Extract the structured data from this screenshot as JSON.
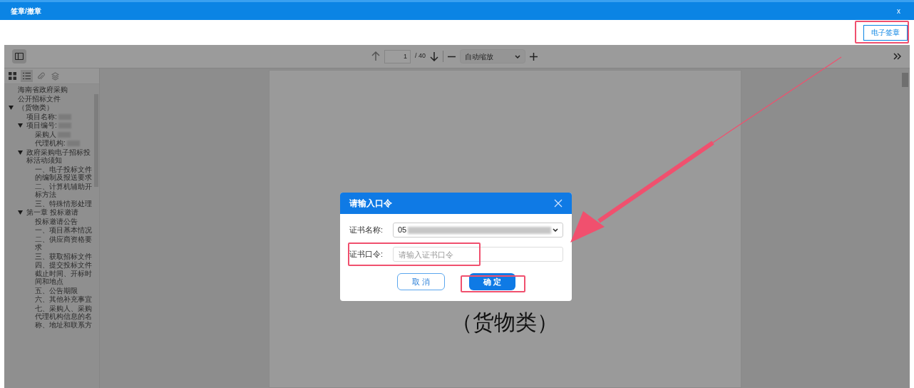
{
  "window": {
    "title": "签章/撤章",
    "close": "x"
  },
  "top_bar": {
    "button": "电子签章"
  },
  "toolbar": {
    "page": "1",
    "page_count": "/ 40",
    "zoom": "自动缩放"
  },
  "sidebar_views": [
    {
      "kind": "thumbnails",
      "selected": false
    },
    {
      "kind": "outline",
      "selected": true
    },
    {
      "kind": "attachments",
      "selected": false
    },
    {
      "kind": "layers",
      "selected": false
    }
  ],
  "outline": {
    "items": [
      {
        "label": "海南省政府采购"
      },
      {
        "label": "公开招标文件"
      },
      {
        "label": "（货物类）",
        "expanded": true,
        "children": [
          {
            "label": "项目名称:",
            "redacted": true
          },
          {
            "label": "项目编号:",
            "redacted": true,
            "expanded": true,
            "children": [
              {
                "label": "采购人",
                "redacted": true
              },
              {
                "label": "代理机构:",
                "redacted": true
              }
            ]
          },
          {
            "label": "政府采购电子招标投标活动须知",
            "expanded": true,
            "children": [
              {
                "label": "一、电子投标文件的编制及报送要求"
              },
              {
                "label": "二、计算机辅助开标方法"
              },
              {
                "label": "三、特殊情形处理"
              }
            ]
          },
          {
            "label": "第一章 投标邀请",
            "expanded": true,
            "children": [
              {
                "label": "投标邀请公告"
              },
              {
                "label": "一、项目基本情况"
              },
              {
                "label": "二、供应商资格要求"
              },
              {
                "label": "三、获取招标文件"
              },
              {
                "label": "四、提交投标文件截止时间、开标时间和地点"
              },
              {
                "label": "五、公告期限"
              },
              {
                "label": "六、其他补充事宜"
              },
              {
                "label": "七、采购人、采购代理机构信息的名称、地址和联系方"
              }
            ]
          }
        ]
      }
    ]
  },
  "document": {
    "line": "（货物类）"
  },
  "dialog": {
    "title": "请输入口令",
    "cert_name_label": "证书名称:",
    "cert_name_value": "05",
    "cert_name_redacted": true,
    "password_label": "证书口令:",
    "password_placeholder": "请输入证书口令",
    "cancel": "取 消",
    "confirm": "确 定"
  }
}
